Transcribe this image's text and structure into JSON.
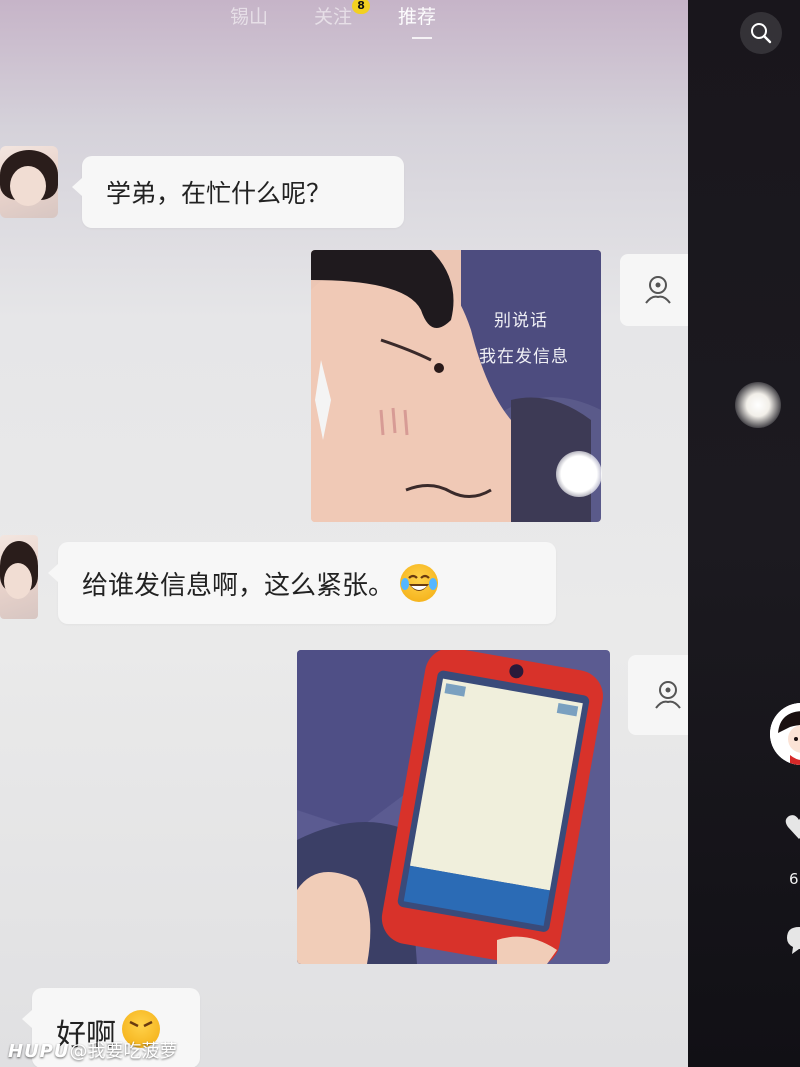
{
  "top_tabs": {
    "location": "锡山",
    "follow": "关注",
    "follow_badge": "8",
    "recommend": "推荐"
  },
  "messages": [
    {
      "side": "left",
      "type": "text",
      "text": "学弟，在忙什么呢？"
    },
    {
      "side": "right",
      "type": "sticker",
      "caption_line1": "别说话",
      "caption_line2": "我在发信息"
    },
    {
      "side": "left",
      "type": "text",
      "text": "给谁发信息啊，这么紧张。",
      "emoji": "tears-of-joy-emoji"
    },
    {
      "side": "right",
      "type": "sticker",
      "caption_line1": "",
      "caption_line2": ""
    },
    {
      "side": "left",
      "type": "text",
      "text": "好啊",
      "emoji": "angry-emoji"
    }
  ],
  "side_panel": {
    "like_count": "6"
  },
  "watermark": {
    "brand": "HUPU",
    "handle": "@我要吃菠萝"
  },
  "colors": {
    "bubble": "#f7f7f7",
    "badge": "#f2d021",
    "bezel": "#19161c"
  }
}
